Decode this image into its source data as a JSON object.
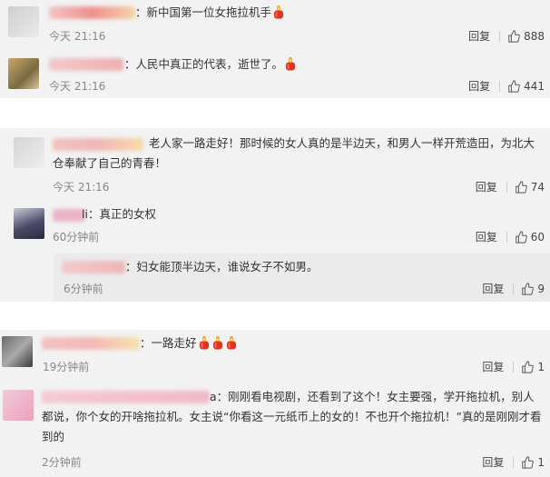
{
  "comments": [
    {
      "text": "：新中国第一位女拖拉机手",
      "time": "今天 21:16",
      "reply": "回复",
      "likes": "888"
    },
    {
      "text": "：人民中真正的代表，逝世了。",
      "time": "今天 21:16",
      "reply": "回复",
      "likes": "441"
    },
    {
      "text": "老人家一路走好！那时候的女人真的是半边天，和男人一样开荒造田，为北大仓奉献了自己的青春！",
      "time": "今天 21:16",
      "reply": "回复",
      "likes": "74"
    },
    {
      "name_suffix": "li",
      "text": "：真正的女权",
      "time": "60分钟前",
      "reply": "回复",
      "likes": "60"
    },
    {
      "text": "：妇女能顶半边天，谁说女子不如男。",
      "time": "6分钟前",
      "reply": "回复",
      "likes": "9"
    },
    {
      "text": "：一路走好",
      "time": "19分钟前",
      "reply": "回复",
      "likes": "1"
    },
    {
      "text": "a：刚刚看电视剧，还看到了这个！女主要强，学开拖拉机，别人都说，你个女的开啥拖拉机。女主说“你看这一元纸币上的女的！不也开个拖拉机！”真的是刚刚才看到的",
      "time": "2分钟前",
      "reply": "回复",
      "likes": "1"
    }
  ],
  "colors": {
    "candle_red": "#e0341f",
    "flame": "#f5a623",
    "time_gray": "#888888"
  }
}
